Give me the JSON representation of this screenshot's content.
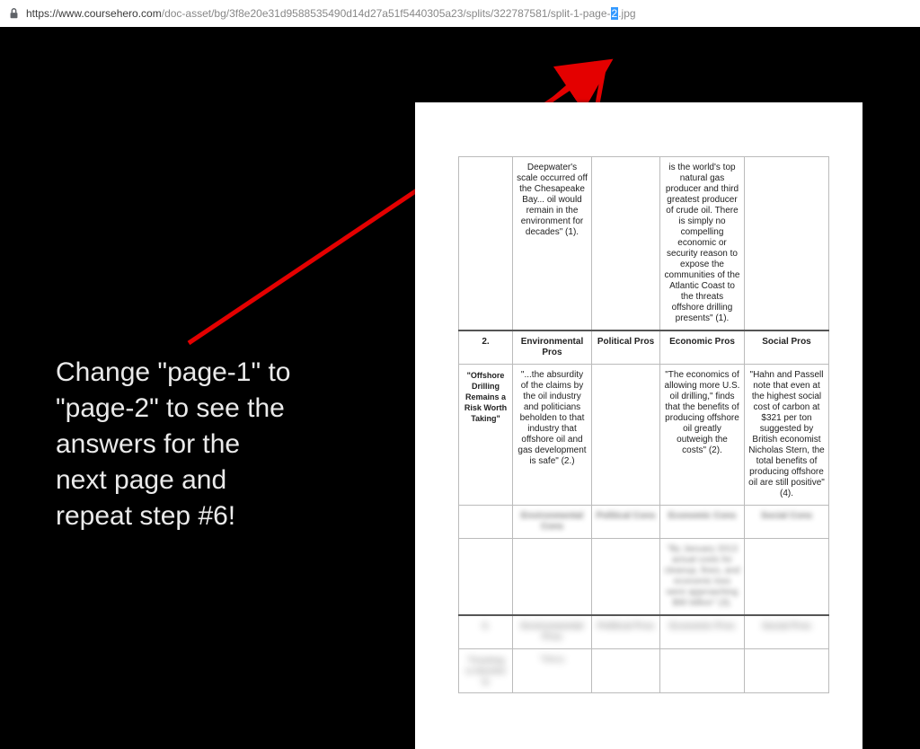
{
  "url": {
    "host": "https://www.coursehero.com",
    "path_before": "/doc-asset/bg/3f8e20e31d9588535490d14d27a51f5440305a23/splits/322787581/split-1-page-",
    "highlighted": "2",
    "path_after": ".jpg"
  },
  "instruction": "Change \"page-1\" to\n\"page-2\" to see the\nanswers for the\nnext page and\nrepeat step #6!",
  "document": {
    "row1": {
      "col2": "Deepwater's scale occurred off the Chesapeake Bay... oil would remain in the environment for decades\" (1).",
      "col4": "is the world's top natural gas producer and third greatest producer of crude oil. There is simply no compelling economic or security reason to expose the communities of the Atlantic Coast to the threats offshore drilling presents\" (1)."
    },
    "row2": {
      "num": "2.",
      "title": "\"Offshore Drilling Remains a Risk Worth Taking\"",
      "h1": "Environmental Pros",
      "h2": "Political Pros",
      "h3": "Economic Pros",
      "h4": "Social Pros",
      "c1": "\"...the absurdity of the claims by the oil industry and politicians beholden to that industry that offshore oil and gas development is safe\" (2.)",
      "c3": "\"The economics of allowing more U.S. oil drilling,\" finds that the benefits of producing offshore oil greatly outweigh the costs\" (2).",
      "c4": "\"Hahn and Passell note that even at the highest social cost of carbon at $321 per ton suggested by British economist Nicholas Stern, the total benefits of producing offshore oil are still positive\" (4)."
    },
    "row3": {
      "h1": "Environmental Cons",
      "h2": "Political Cons",
      "h3": "Economic Cons",
      "h4": "Social Cons",
      "c3": "\"By January 2013 actual costs for cleanup, fines, and economic loss were approaching $90 billion\" (3)."
    },
    "row4": {
      "num": "3.",
      "title": "\"Fracking is Harmful to",
      "h1": "Environmental Pros",
      "h2": "Political Pros",
      "h3": "Economic Pros",
      "h4": "Social Pros",
      "c1": "\"Many"
    }
  }
}
